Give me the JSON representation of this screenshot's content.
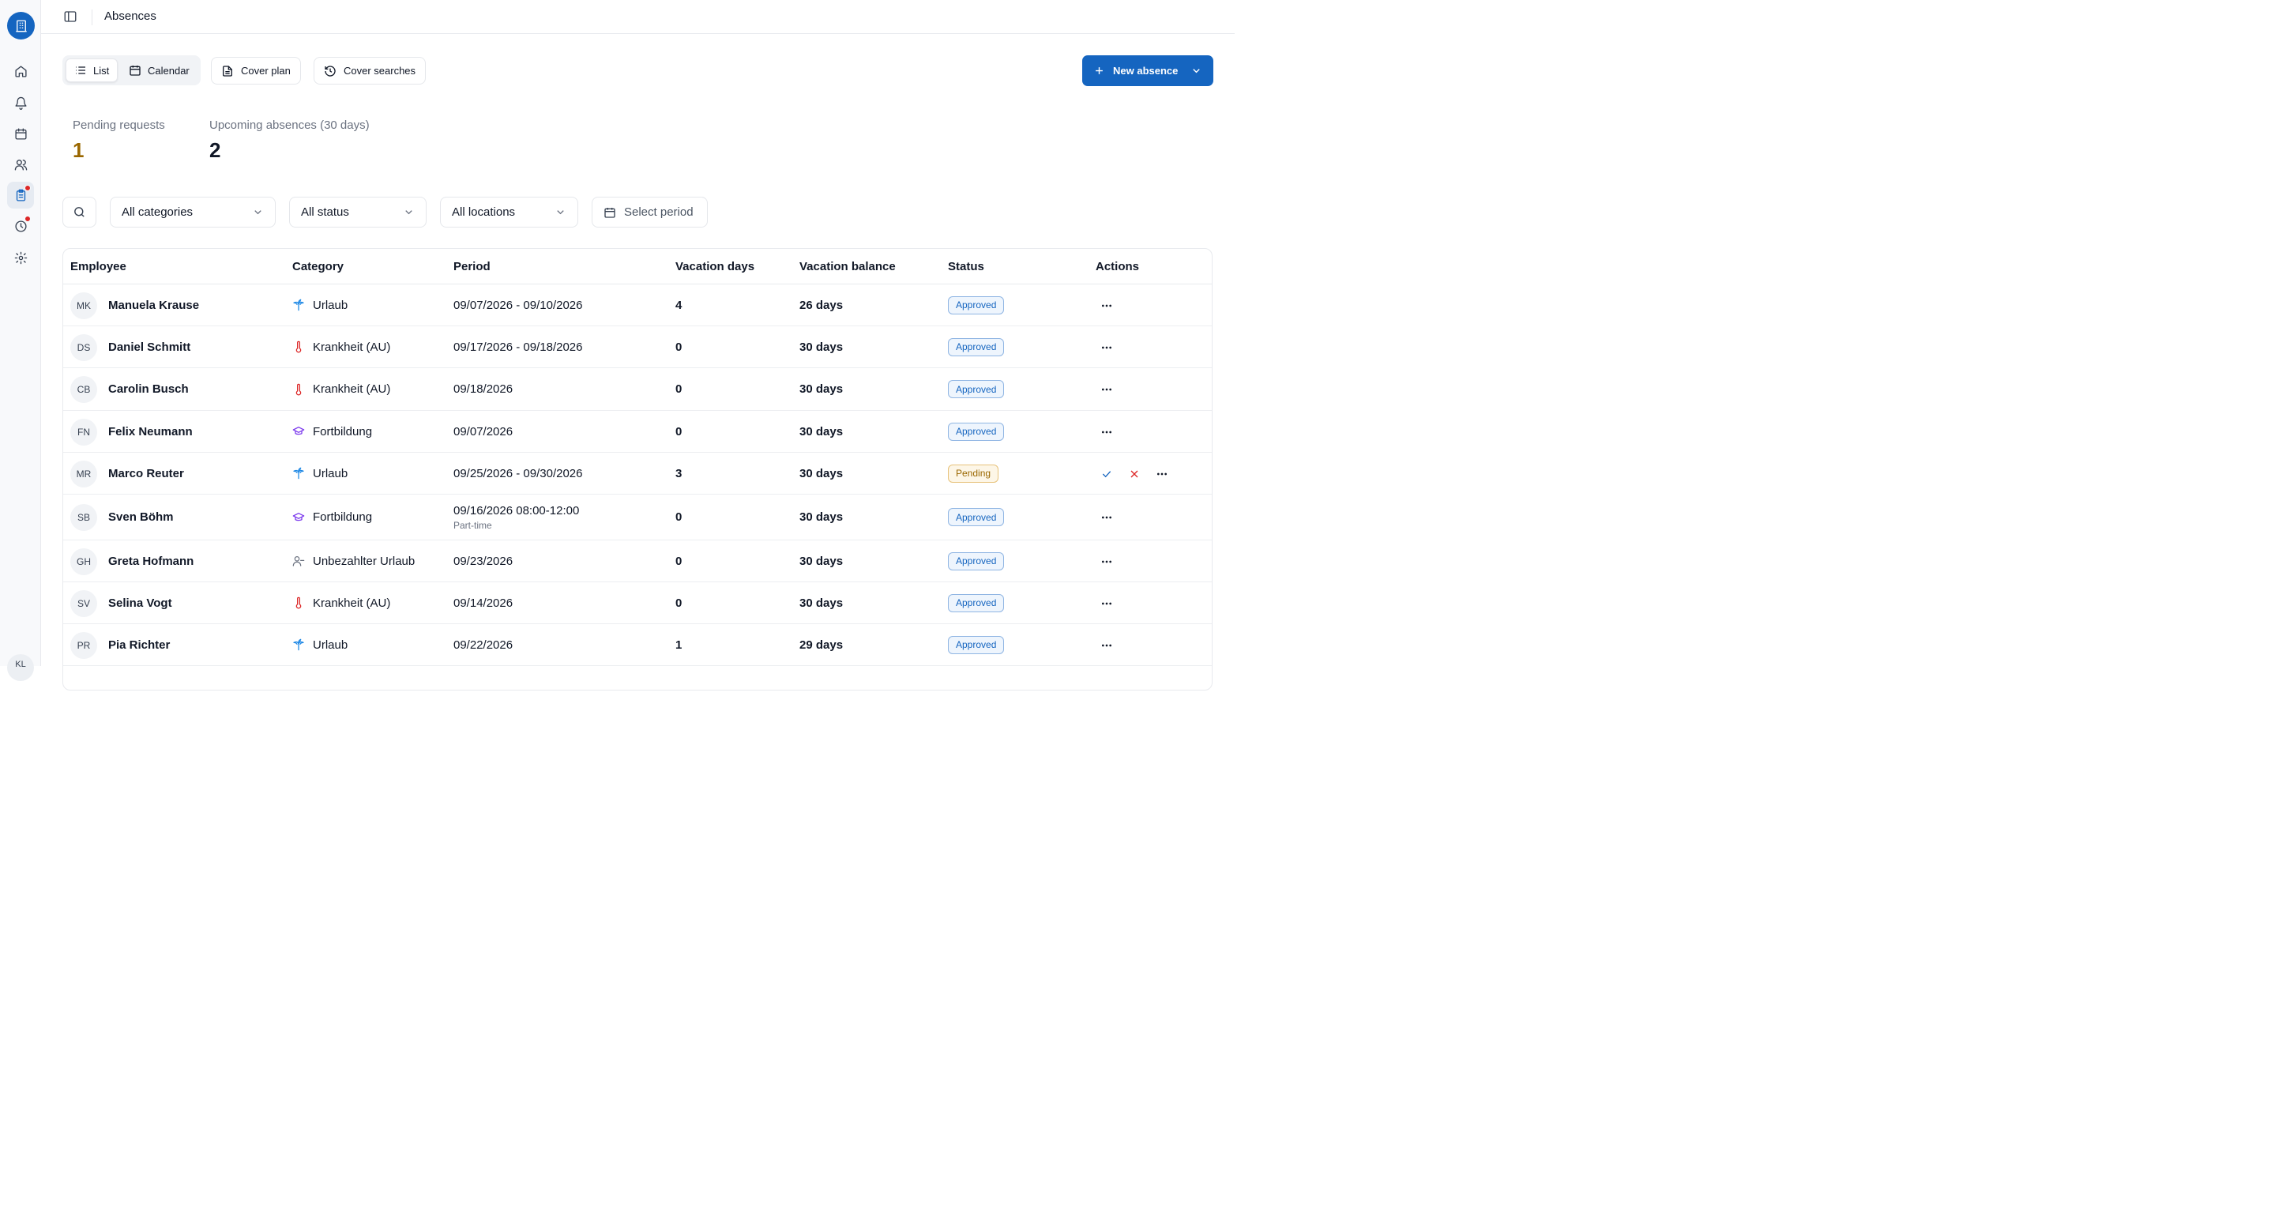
{
  "sidebar": {
    "logo_icon": "building-icon",
    "items": [
      {
        "icon": "home-icon",
        "active": false,
        "dot": false
      },
      {
        "icon": "bell-icon",
        "active": false,
        "dot": false
      },
      {
        "icon": "calendar-icon",
        "active": false,
        "dot": false
      },
      {
        "icon": "users-icon",
        "active": false,
        "dot": false
      },
      {
        "icon": "clipboard-icon",
        "active": true,
        "dot": true
      },
      {
        "icon": "clock-icon",
        "active": false,
        "dot": true
      },
      {
        "icon": "gear-icon",
        "active": false,
        "dot": false
      }
    ],
    "user_initials": "KL"
  },
  "header": {
    "title": "Absences"
  },
  "toolbar": {
    "views": [
      {
        "label": "List",
        "active": true
      },
      {
        "label": "Calendar",
        "active": false
      }
    ],
    "cover_plan": "Cover plan",
    "cover_searches": "Cover searches",
    "new_absence": "New absence"
  },
  "stats": {
    "pending_label": "Pending requests",
    "pending_value": "1",
    "upcoming_label": "Upcoming absences (30 days)",
    "upcoming_value": "2"
  },
  "filters": {
    "categories": "All categories",
    "status": "All status",
    "locations": "All locations",
    "period": "Select period"
  },
  "table": {
    "headers": {
      "employee": "Employee",
      "category": "Category",
      "period": "Period",
      "vacation_days": "Vacation days",
      "vacation_balance": "Vacation balance",
      "status": "Status",
      "actions": "Actions"
    },
    "rows": [
      {
        "initials": "MK",
        "name": "Manuela Krause",
        "category": "Urlaub",
        "cat_icon": "palm-tree-icon",
        "period": "09/07/2026 - 09/10/2026",
        "period_sub": "",
        "vacation_days": "4",
        "balance": "26 days",
        "status": "Approved",
        "status_kind": "approved"
      },
      {
        "initials": "DS",
        "name": "Daniel Schmitt",
        "category": "Krankheit (AU)",
        "cat_icon": "thermometer-icon",
        "period": "09/17/2026 - 09/18/2026",
        "period_sub": "",
        "vacation_days": "0",
        "balance": "30 days",
        "status": "Approved",
        "status_kind": "approved"
      },
      {
        "initials": "CB",
        "name": "Carolin Busch",
        "category": "Krankheit (AU)",
        "cat_icon": "thermometer-icon",
        "period": "09/18/2026",
        "period_sub": "",
        "vacation_days": "0",
        "balance": "30 days",
        "status": "Approved",
        "status_kind": "approved"
      },
      {
        "initials": "FN",
        "name": "Felix Neumann",
        "category": "Fortbildung",
        "cat_icon": "graduation-cap-icon",
        "period": "09/07/2026",
        "period_sub": "",
        "vacation_days": "0",
        "balance": "30 days",
        "status": "Approved",
        "status_kind": "approved"
      },
      {
        "initials": "MR",
        "name": "Marco Reuter",
        "category": "Urlaub",
        "cat_icon": "palm-tree-icon",
        "period": "09/25/2026 - 09/30/2026",
        "period_sub": "",
        "vacation_days": "3",
        "balance": "30 days",
        "status": "Pending",
        "status_kind": "pending"
      },
      {
        "initials": "SB",
        "name": "Sven Böhm",
        "category": "Fortbildung",
        "cat_icon": "graduation-cap-icon",
        "period": "09/16/2026 08:00-12:00",
        "period_sub": "Part-time",
        "vacation_days": "0",
        "balance": "30 days",
        "status": "Approved",
        "status_kind": "approved"
      },
      {
        "initials": "GH",
        "name": "Greta Hofmann",
        "category": "Unbezahlter Urlaub",
        "cat_icon": "user-minus-icon",
        "period": "09/23/2026",
        "period_sub": "",
        "vacation_days": "0",
        "balance": "30 days",
        "status": "Approved",
        "status_kind": "approved"
      },
      {
        "initials": "SV",
        "name": "Selina Vogt",
        "category": "Krankheit (AU)",
        "cat_icon": "thermometer-icon",
        "period": "09/14/2026",
        "period_sub": "",
        "vacation_days": "0",
        "balance": "30 days",
        "status": "Approved",
        "status_kind": "approved"
      },
      {
        "initials": "PR",
        "name": "Pia Richter",
        "category": "Urlaub",
        "cat_icon": "palm-tree-icon",
        "period": "09/22/2026",
        "period_sub": "",
        "vacation_days": "1",
        "balance": "29 days",
        "status": "Approved",
        "status_kind": "approved"
      }
    ]
  },
  "colors": {
    "accent": "#1565c0",
    "pending_value": "#9a6700",
    "badge_dot": "#dc2626",
    "cat_urlaub": "#1e88e5",
    "cat_krankheit": "#dc2626",
    "cat_fortbildung": "#7c3aed",
    "cat_unbezahlt": "#6b7280",
    "approve": "#1565c0",
    "reject": "#dc2626"
  }
}
